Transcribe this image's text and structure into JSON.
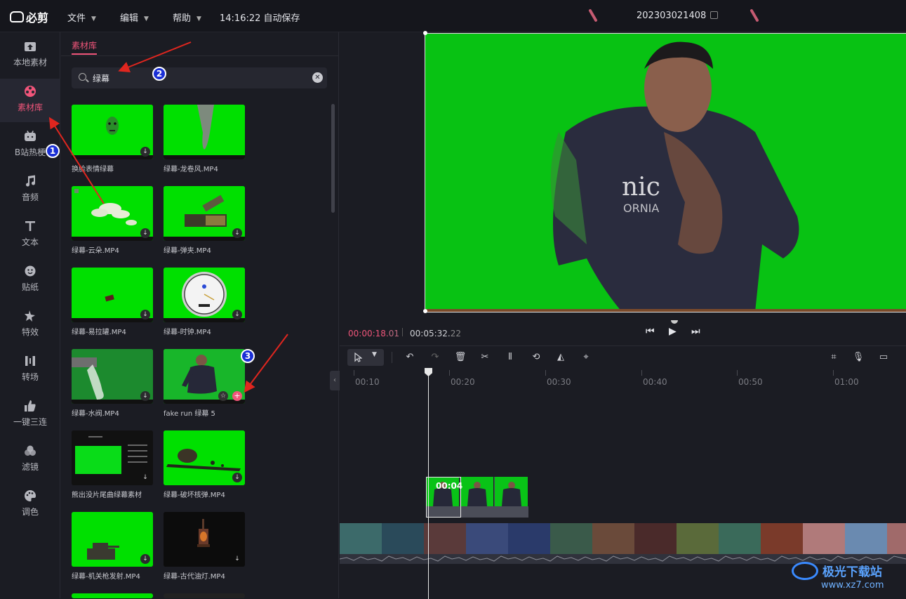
{
  "app": {
    "name": "必剪"
  },
  "menu": {
    "file": "文件",
    "edit": "编辑",
    "help": "帮助"
  },
  "autosave": "14:16:22 自动保存",
  "project_title": "202303021408",
  "nav": [
    {
      "label": "本地素材",
      "icon": "upload-icon"
    },
    {
      "label": "素材库",
      "icon": "film-reel-icon",
      "active": true
    },
    {
      "label": "B站热梗",
      "icon": "bilibili-tv-icon"
    },
    {
      "label": "音频",
      "icon": "music-note-icon"
    },
    {
      "label": "文本",
      "icon": "text-t-icon"
    },
    {
      "label": "贴纸",
      "icon": "sticker-icon"
    },
    {
      "label": "特效",
      "icon": "sparkle-star-icon"
    },
    {
      "label": "转场",
      "icon": "transition-icon"
    },
    {
      "label": "一键三连",
      "icon": "thumbs-up-icon"
    },
    {
      "label": "滤镜",
      "icon": "filter-circles-icon"
    },
    {
      "label": "调色",
      "icon": "palette-icon"
    }
  ],
  "library": {
    "tab": "素材库",
    "search_value": "绿幕",
    "items": [
      {
        "caption": "换脸表情绿幕"
      },
      {
        "caption": "绿幕-龙卷风.MP4"
      },
      {
        "caption": "绿幕-云朵.MP4"
      },
      {
        "caption": "绿幕-弹夹.MP4"
      },
      {
        "caption": "绿幕-易拉罐.MP4"
      },
      {
        "caption": "绿幕-时钟.MP4"
      },
      {
        "caption": "绿幕-水阀.MP4"
      },
      {
        "caption": "fake run 绿幕 5"
      },
      {
        "caption": "熊出没片尾曲绿幕素材"
      },
      {
        "caption": "绿幕-破坏核弹.MP4"
      },
      {
        "caption": "绿幕-机关枪发射.MP4"
      },
      {
        "caption": "绿幕-古代油灯.MP4"
      }
    ]
  },
  "player": {
    "current_time_main": "00:00:18.",
    "current_time_frac": "01",
    "total_time_main": "00:05:32.",
    "total_time_frac": "22"
  },
  "timeline": {
    "ruler": [
      "00:10",
      "00:20",
      "00:30",
      "00:40",
      "00:50",
      "01:00"
    ],
    "clip_label": "00:04"
  },
  "annotations": [
    "1",
    "2",
    "3"
  ],
  "watermark": {
    "name": "极光下载站",
    "url": "www.xz7.com"
  },
  "colors": {
    "accent": "#f0557a",
    "green_screen": "#08c213",
    "annotation": "#1a2fd6"
  }
}
